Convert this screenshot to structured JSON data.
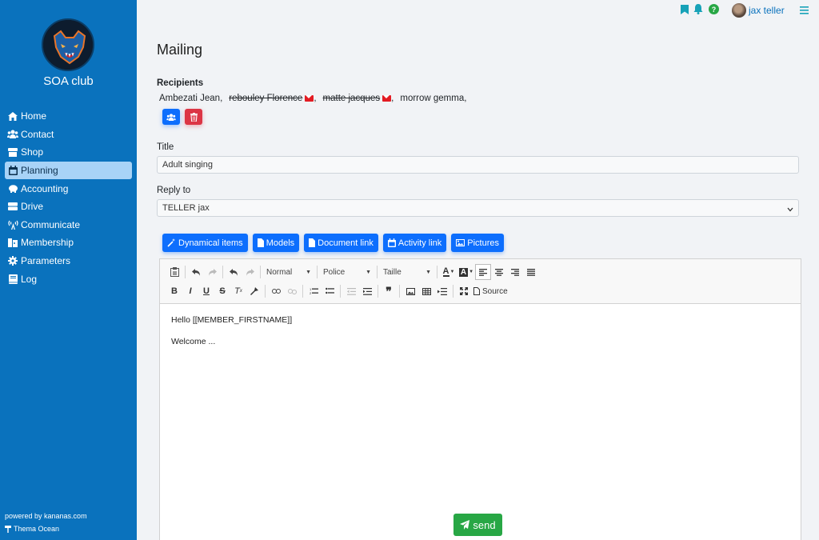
{
  "sidebar": {
    "club_name": "SOA club",
    "items": [
      {
        "label": "Home",
        "icon": "home-icon"
      },
      {
        "label": "Contact",
        "icon": "users-icon"
      },
      {
        "label": "Shop",
        "icon": "store-icon"
      },
      {
        "label": "Planning",
        "icon": "calendar-icon",
        "active": true
      },
      {
        "label": "Accounting",
        "icon": "piggy-bank-icon"
      },
      {
        "label": "Drive",
        "icon": "drive-icon"
      },
      {
        "label": "Communicate",
        "icon": "broadcast-icon"
      },
      {
        "label": "Membership",
        "icon": "id-card-icon"
      },
      {
        "label": "Parameters",
        "icon": "gear-icon"
      },
      {
        "label": "Log",
        "icon": "book-icon"
      }
    ],
    "powered_by": "powered by kananas.com",
    "theme": "Thema Ocean"
  },
  "topbar": {
    "user_name": "jax teller",
    "help_label": "?"
  },
  "main": {
    "title": "Mailing",
    "recipients_label": "Recipients",
    "recipients": [
      {
        "name": "Ambezati Jean",
        "struck": false
      },
      {
        "name": "rebouley Florence",
        "struck": true
      },
      {
        "name": "matte jacques",
        "struck": true
      },
      {
        "name": "morrow gemma",
        "struck": false
      }
    ],
    "title_label": "Title",
    "title_value": "Adult singing",
    "reply_label": "Reply to",
    "reply_value": "TELLER jax",
    "buttons": {
      "dynamical": "Dynamical items",
      "models": "Models",
      "document_link": "Document link",
      "activity_link": "Activity link",
      "pictures": "Pictures"
    },
    "editor": {
      "format_combo": "Normal",
      "font_combo": "Police",
      "size_combo": "Taille",
      "source_label": "Source",
      "line1": "Hello [[MEMBER_FIRSTNAME]]",
      "line2": "Welcome ..."
    },
    "send_label": "send"
  },
  "colors": {
    "sidebar": "#0a72bd",
    "primary": "#0d6efd",
    "danger": "#dc3545",
    "success": "#28a745",
    "background": "#f1f3f6"
  }
}
